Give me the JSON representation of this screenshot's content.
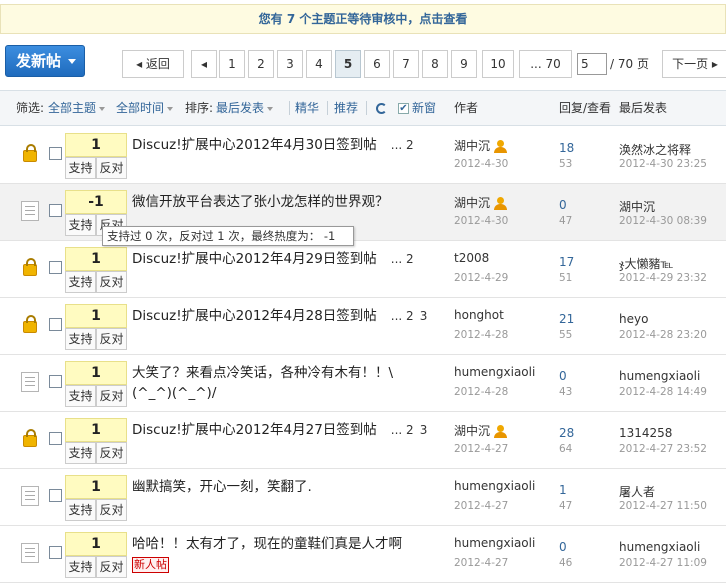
{
  "notice": "您有 7 个主题正等待审核中，点击查看",
  "post_button": "发新帖",
  "pager": {
    "prev": "◂ 返回",
    "prev_arrow": "◂",
    "pages": [
      "1",
      "2",
      "3",
      "4",
      "5",
      "6",
      "7",
      "8",
      "9",
      "10",
      "... 70"
    ],
    "current": "5",
    "input_value": "5",
    "total": "/ 70 页",
    "next": "下一页 ▸"
  },
  "filter": {
    "label": "筛选:",
    "all_topics": "全部主题",
    "all_time": "全部时间",
    "sort_label": "排序:",
    "sort_value": "最后发表",
    "digest": "精华",
    "recommend": "推荐",
    "new_window": "新窗",
    "check_mark": "✔",
    "col_author": "作者",
    "col_reply_view": "回复/查看",
    "col_lastpost": "最后发表"
  },
  "tooltip": "支持过 0 次，反对过 1 次，最终热度为： -1",
  "vote_labels": {
    "up": "支持",
    "down": "反对"
  },
  "threads": [
    {
      "icon": "lock-icon",
      "score": "1",
      "title": "Discuz!扩展中心2012年4月30日签到帖",
      "pages": [
        "... 2"
      ],
      "author": "湖中沉",
      "author_icon": true,
      "date": "2012-4-30",
      "replies": "18",
      "views": "53",
      "last_user": "涣然冰之将释",
      "last_date": "2012-4-30 23:25"
    },
    {
      "icon": "doc-icon",
      "score": "-1",
      "title": "微信开放平台表达了张小龙怎样的世界观？",
      "pages": [],
      "author": "湖中沉",
      "author_icon": true,
      "date": "2012-4-30",
      "replies": "0",
      "views": "47",
      "last_user": "湖中沉",
      "last_date": "2012-4-30 08:39"
    },
    {
      "icon": "lock-icon",
      "score": "1",
      "title": "Discuz!扩展中心2012年4月29日签到帖",
      "pages": [
        "... 2"
      ],
      "author": "t2008",
      "author_icon": false,
      "date": "2012-4-29",
      "replies": "17",
      "views": "51",
      "last_user": "ჯ大懒豬℡",
      "last_date": "2012-4-29 23:32"
    },
    {
      "icon": "lock-icon",
      "score": "1",
      "title": "Discuz!扩展中心2012年4月28日签到帖",
      "pages": [
        "... 2",
        "3"
      ],
      "author": "honghot",
      "author_icon": false,
      "date": "2012-4-28",
      "replies": "21",
      "views": "55",
      "last_user": "heyo",
      "last_date": "2012-4-28 23:20"
    },
    {
      "icon": "doc-icon",
      "score": "1",
      "title": "大笑了？来看点冷笑话，各种冷有木有！！\\(^_^)(^_^)/",
      "pages": [],
      "author": "humengxiaoli",
      "author_icon": false,
      "date": "2012-4-28",
      "replies": "0",
      "views": "43",
      "last_user": "humengxiaoli",
      "last_date": "2012-4-28 14:49"
    },
    {
      "icon": "lock-icon",
      "score": "1",
      "title": "Discuz!扩展中心2012年4月27日签到帖",
      "pages": [
        "... 2",
        "3"
      ],
      "author": "湖中沉",
      "author_icon": true,
      "date": "2012-4-27",
      "replies": "28",
      "views": "64",
      "last_user": "1314258",
      "last_date": "2012-4-27 23:52"
    },
    {
      "icon": "doc-icon",
      "score": "1",
      "title": "幽默搞笑，开心一刻，笑翻了.",
      "pages": [],
      "author": "humengxiaoli",
      "author_icon": false,
      "date": "2012-4-27",
      "replies": "1",
      "views": "47",
      "last_user": "屠人者",
      "last_date": "2012-4-27 11:50"
    },
    {
      "icon": "doc-icon",
      "score": "1",
      "title": "哈哈！！太有才了，现在的童鞋们真是人才啊",
      "pages": [],
      "badge": "新人帖",
      "author": "humengxiaoli",
      "author_icon": false,
      "date": "2012-4-27",
      "replies": "0",
      "views": "46",
      "last_user": "humengxiaoli",
      "last_date": "2012-4-27 11:09"
    }
  ]
}
